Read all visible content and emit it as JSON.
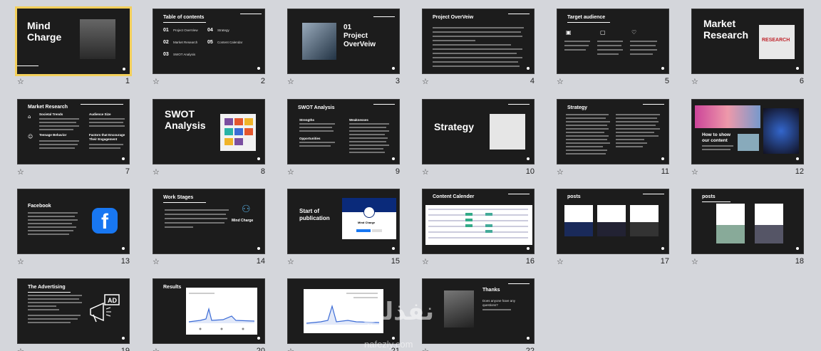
{
  "slides": [
    {
      "num": "1",
      "title": "Mind\nCharge"
    },
    {
      "num": "2",
      "title": "Table of contents",
      "items": [
        "01",
        "Project OverView",
        "02",
        "Market Research",
        "03",
        "SWOT Analysis",
        "04",
        "Strategy",
        "05",
        "Content Calendar"
      ]
    },
    {
      "num": "3",
      "title": "01\nProject\nOverVeiw"
    },
    {
      "num": "4",
      "title": "Project OverVeiw"
    },
    {
      "num": "5",
      "title": "Target audience"
    },
    {
      "num": "6",
      "title": "Market\nResearch",
      "image_text": "RESEARCH"
    },
    {
      "num": "7",
      "title": "Market Research",
      "sub": [
        "Societal Trends",
        "Audience Size",
        "Teenage Behavior",
        "Factors that Encourage Their Engagement"
      ]
    },
    {
      "num": "8",
      "title": "SWOT\nAnalysis"
    },
    {
      "num": "9",
      "title": "SWOT Analysis",
      "sub": [
        "Strengths",
        "Weaknesses",
        "Opportunities"
      ]
    },
    {
      "num": "10",
      "title": "Strategy"
    },
    {
      "num": "11",
      "title": "Strategy"
    },
    {
      "num": "12",
      "title": "How to show\nour content"
    },
    {
      "num": "13",
      "title": "Facebook"
    },
    {
      "num": "14",
      "title": "Work Stages",
      "logo": "Mind Charge"
    },
    {
      "num": "15",
      "title": "Start of\npublication",
      "logo": "Mind Charge"
    },
    {
      "num": "16",
      "title": "Content Calender"
    },
    {
      "num": "17",
      "title": "posts"
    },
    {
      "num": "18",
      "title": "posts"
    },
    {
      "num": "19",
      "title": "The Advertising",
      "icon_text": "AD"
    },
    {
      "num": "20",
      "title": "Results"
    },
    {
      "num": "21",
      "title": ""
    },
    {
      "num": "22",
      "title": "Thanks",
      "sub": [
        "Does anyone have any questions?"
      ]
    }
  ],
  "watermark": {
    "arabic": "نفذلي",
    "latin": "nafezly.com"
  },
  "icons": {
    "star": "☆"
  }
}
